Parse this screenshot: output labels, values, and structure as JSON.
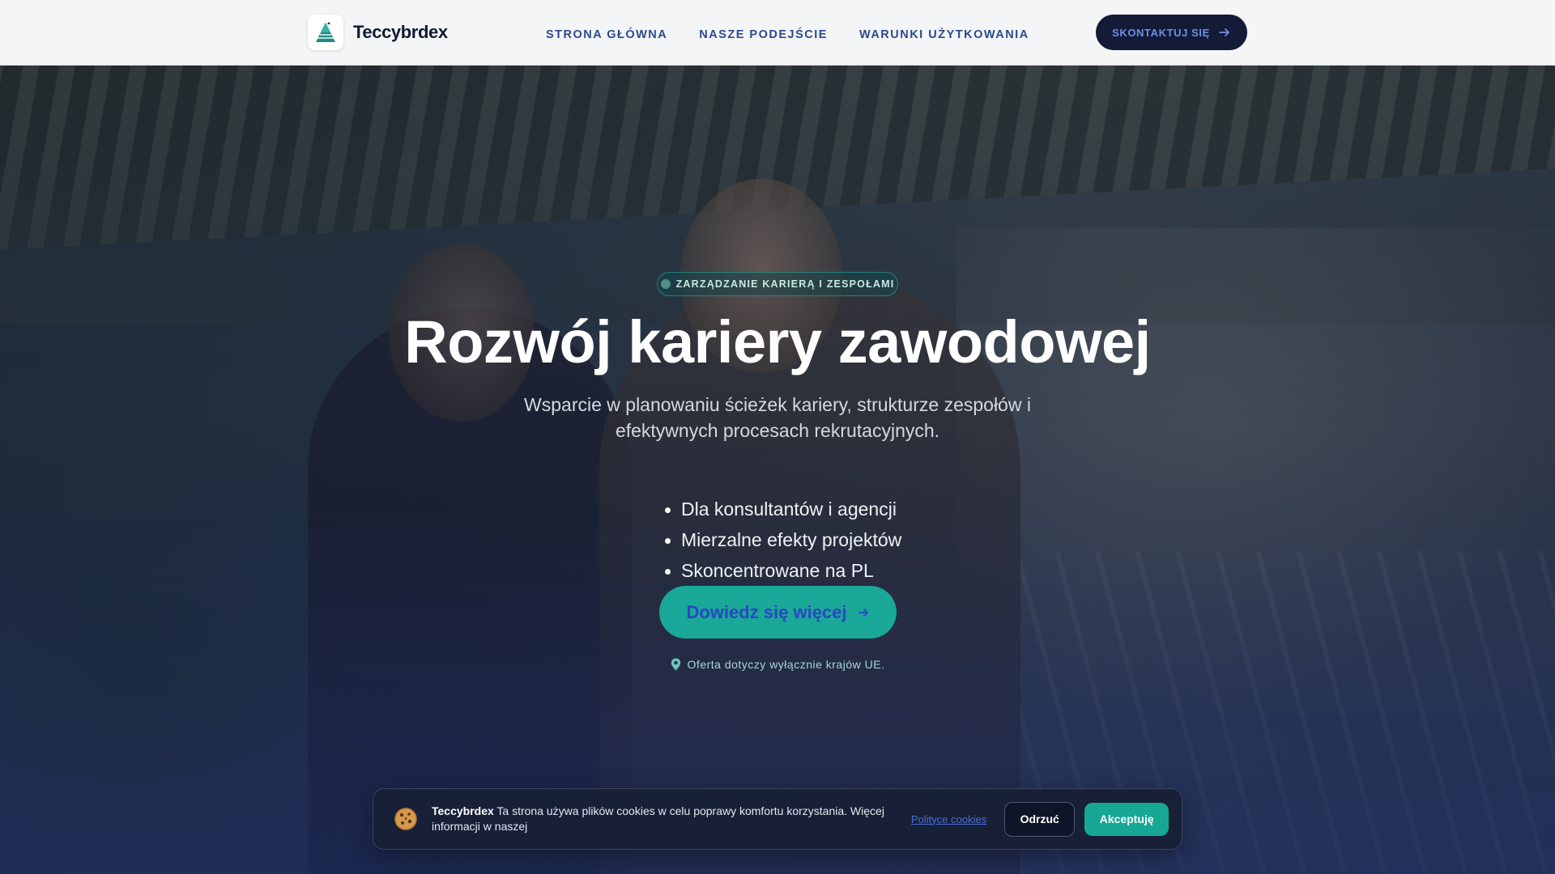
{
  "header": {
    "logo_icon": "pyramid-logo-icon",
    "brand": "Teccybrdex",
    "nav": [
      {
        "label": "STRONA GŁÓWNA"
      },
      {
        "label": "NASZE PODEJŚCIE"
      },
      {
        "label": "WARUNKI UŻYTKOWANIA"
      }
    ],
    "contact_label": "SKONTAKTUJ SIĘ",
    "contact_icon": "arrow-right-icon"
  },
  "hero": {
    "badge": "ZARZĄDZANIE KARIERĄ I ZESPOŁAMI",
    "title": "Rozwój kariery zawodowej",
    "subtitle": "Wsparcie w planowaniu ścieżek kariery, strukturze zespołów i efektywnych procesach rekrutacyjnych.",
    "features": [
      "Dla konsultantów i agencji",
      "Mierzalne efekty projektów",
      "Skoncentrowane na PL"
    ],
    "cta_label": "Dowiedz się więcej",
    "cta_icon": "arrow-right-icon",
    "note_icon": "location-pin-icon",
    "note": "Oferta dotyczy wyłącznie krajów UE."
  },
  "cookie_banner": {
    "icon": "cookie-icon",
    "brand": "Teccybrdex",
    "text": " Ta strona używa plików cookies w celu poprawy komfortu korzystania. Więcej informacji w naszej",
    "policy_link": "Polityce cookies",
    "reject_label": "Odrzuć",
    "accept_label": "Akceptuję"
  },
  "colors": {
    "header_bg": "#f4f5f6",
    "nav_text": "#2b4a8e",
    "dark_button": "#131b36",
    "accent_teal": "#1aa898",
    "cta_text": "#2a46c4"
  }
}
